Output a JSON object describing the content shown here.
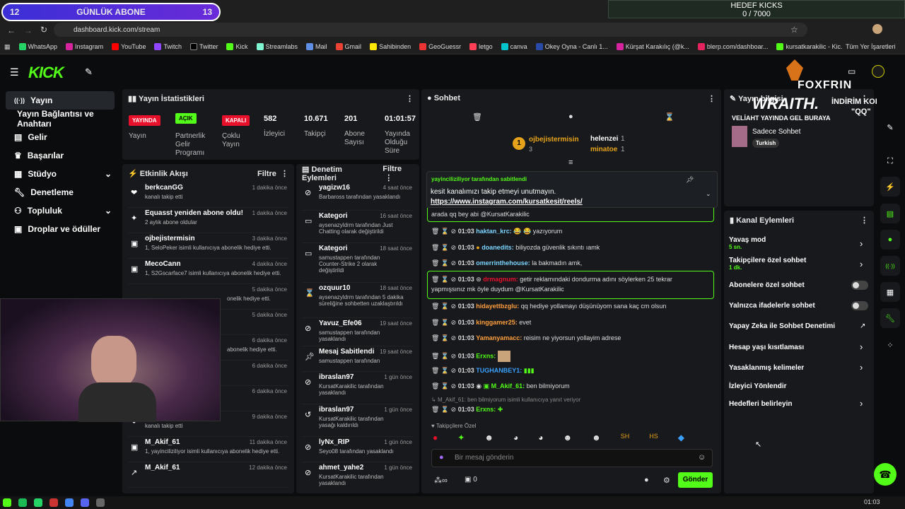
{
  "overlay": {
    "sub_left": "12",
    "sub_title": "GÜNLÜK ABONE",
    "sub_right": "13",
    "kicks_title": "HEDEF KICKS",
    "kicks_value": "0 / 7000",
    "brand": "FOXFRIN",
    "promo_title": "WRAITH.",
    "promo_text": "İNDİRİM KODU:",
    "promo_code": "\"QQ\""
  },
  "browser": {
    "url": "dashboard.kick.com/stream",
    "bookmarks": [
      "WhatsApp",
      "Instagram",
      "YouTube",
      "Twitch",
      "Twitter",
      "Kick",
      "Streamlabs",
      "Mail",
      "Gmail",
      "Sahibinden",
      "GeoGuessr",
      "letgo",
      "canva",
      "Okey Oyna - Canlı 1...",
      "Kürşat Karakılıç (@k...",
      "blerp.com/dashboar...",
      "kursatkarakilic - Kic..."
    ],
    "all_bookmarks": "Tüm Yer İşaretleri"
  },
  "app": {
    "logo": "KICK"
  },
  "sidebar": {
    "items": [
      {
        "label": "Yayın",
        "icon": "stream-icon"
      },
      {
        "label": "Yayın Bağlantısı ve Anahtarı",
        "icon": ""
      },
      {
        "label": "Gelir",
        "icon": "revenue-icon"
      },
      {
        "label": "Başarılar",
        "icon": "trophy-icon"
      },
      {
        "label": "Stüdyo",
        "icon": "studio-icon"
      },
      {
        "label": "Denetleme",
        "icon": "wrench-icon"
      },
      {
        "label": "Topluluk",
        "icon": "community-icon"
      },
      {
        "label": "Droplar ve ödüller",
        "icon": "gift-icon"
      }
    ]
  },
  "stats": {
    "title": "Yayın İstatistikleri",
    "live_badge": "YAYINDA",
    "live_label": "Yayın",
    "partner_badge": "AÇIK",
    "partner_label": "Partnerlik Gelir Programı",
    "multi_badge": "KAPALI",
    "multi_label": "Çoklu Yayın",
    "viewers": "582",
    "viewers_label": "İzleyici",
    "followers": "10.671",
    "followers_label": "Takipçi",
    "subs": "201",
    "subs_label": "Abone Sayısı",
    "uptime": "01:01:57",
    "uptime_label": "Yayında Olduğu Süre"
  },
  "activity": {
    "title": "Etkinlik Akışı",
    "filter": "Filtre",
    "events": [
      {
        "name": "berkcanGG",
        "time": "1 dakika önce",
        "desc": "kanalı takip etti"
      },
      {
        "name": "Equasst yeniden abone oldu!",
        "time": "1 dakika önce",
        "desc": "2 aylık abone oldular"
      },
      {
        "name": "ojbejistermisin",
        "time": "3 dakika önce",
        "desc": "1, SeloPeker isimli kullanıcıya abonelik hediye etti."
      },
      {
        "name": "MecoCann",
        "time": "4 dakika önce",
        "desc": "1, S2Gscarface7 isimli kullanıcıya abonelik hediye etti."
      },
      {
        "name": "",
        "time": "5 dakika önce",
        "desc": "onelik hediye etti."
      },
      {
        "name": "",
        "time": "5 dakika önce",
        "desc": ""
      },
      {
        "name": "",
        "time": "6 dakika önce",
        "desc": "abonelik hediye etti."
      },
      {
        "name": "",
        "time": "6 dakika önce",
        "desc": ""
      },
      {
        "name": "",
        "time": "6 dakika önce",
        "desc": ""
      },
      {
        "name": "myg0303",
        "time": "9 dakika önce",
        "desc": "kanalı takip etti"
      },
      {
        "name": "M_Akif_61",
        "time": "11 dakika önce",
        "desc": "1, yayinciliziliyor isimli kullanıcıya abonelik hediye etti."
      },
      {
        "name": "M_Akif_61",
        "time": "12 dakika önce",
        "desc": ""
      }
    ]
  },
  "modlog": {
    "title": "Denetim Eylemleri",
    "filter": "Filtre",
    "events": [
      {
        "name": "yagizw16",
        "time": "4 saat önce",
        "desc": "Barbaross tarafından yasaklandı"
      },
      {
        "name": "Kategori",
        "time": "16 saat önce",
        "desc": "aysenazyldrm tarafından Just Chatting olarak değiştirildi"
      },
      {
        "name": "Kategori",
        "time": "18 saat önce",
        "desc": "samustappen tarafından Counter-Strike 2 olarak değiştirildi"
      },
      {
        "name": "ozquur10",
        "time": "18 saat önce",
        "desc": "aysenazyldrm tarafından 5 dakika süreliğine sohbetten uzaklaştırıldı"
      },
      {
        "name": "Yavuz_Efe06",
        "time": "19 saat önce",
        "desc": "samustappen tarafından yasaklandı"
      },
      {
        "name": "Mesaj Sabitlendi",
        "time": "19 saat önce",
        "desc": "samustappen tarafından"
      },
      {
        "name": "ibraslan97",
        "time": "1 gün önce",
        "desc": "KursatKarakilic tarafından yasaklandı"
      },
      {
        "name": "ibraslan97",
        "time": "1 gün önce",
        "desc": "KursatKarakilic tarafından yasağı kaldırıldı"
      },
      {
        "name": "lyNx_RIP",
        "time": "1 gün önce",
        "desc": "Seyo08 tarafından yasaklandı"
      },
      {
        "name": "ahmet_yahe2",
        "time": "1 gün önce",
        "desc": "KursatKarakilic tarafından yasaklandı"
      }
    ]
  },
  "chat": {
    "title": "Sohbet",
    "top_gifter": "ojbejistermisin",
    "top_gifter_count": "3",
    "gifter2": "helenzei",
    "gifter2_count": "1",
    "gifter3": "minatoe",
    "gifter3_count": "1",
    "pinned_by": "yayinciliziliyor tarafından sabitlendi",
    "pinned_text": "kesit kanalımızı takip etmeyi unutmayın.",
    "pinned_link": "https://www.instagram.com/kursatkesit/reels/",
    "partial_msg": "arada qq bey abi @KursatKarakilic",
    "messages": [
      {
        "time": "01:03",
        "user": "haktan_krc:",
        "text": "😂 😂 yazıyorum"
      },
      {
        "time": "01:03",
        "user": "doanedits:",
        "text": "biliyozda güvenlik sıkıntı ıamk"
      },
      {
        "time": "01:03",
        "user": "omerrinthehouse:",
        "text": "la bakmadın amk,"
      },
      {
        "time": "01:03",
        "user": "drmagnum:",
        "text": "getir reklamındaki dondurma adını söylerken 25 tekrar"
      },
      {
        "time": "",
        "user": "",
        "text": "yapmışsınız mk öyle duydum @KursatKarakilic"
      },
      {
        "time": "01:03",
        "user": "hidayettbzglu:",
        "text": "qq hediye yollamayı düşünüyom sana kaç cm olsun"
      },
      {
        "time": "01:03",
        "user": "kinggamer25:",
        "text": "evet"
      },
      {
        "time": "01:03",
        "user": "Yamanyamacc:",
        "text": "reisim ne yiyorsun yollayim adrese"
      },
      {
        "time": "01:03",
        "user": "Erxns:",
        "text": ""
      },
      {
        "time": "01:03",
        "user": "TUGHANBEY1:",
        "text": ""
      },
      {
        "time": "01:03",
        "user": "M_Akif_61:",
        "text": "ben bilmiyorum"
      },
      {
        "time": "01:03",
        "user": "Erxns:",
        "text": ""
      }
    ],
    "reply_note": "M_Akif_61: ben bilmiyorum isimli kullanıcıya yanıt veriyor",
    "followers_only": "Takipçilere Özel",
    "placeholder": "Bir mesaj gönderin",
    "counter": "0",
    "send": "Gönder"
  },
  "info": {
    "title": "Yayın bilgisi",
    "stream_title": "VELİAHT YAYINDA GEL BURAYA",
    "category": "Sadece Sohbet",
    "tag": "Turkish"
  },
  "actions": {
    "title": "Kanal Eylemleri",
    "items": [
      {
        "label": "Yavaş mod",
        "sub": "5 sn."
      },
      {
        "label": "Takipçilere özel sohbet",
        "sub": "1 dk."
      },
      {
        "label": "Abonelere özel sohbet",
        "sub": ""
      },
      {
        "label": "Yalnızca ifadelerle sohbet",
        "sub": ""
      },
      {
        "label": "Yapay Zeka ile Sohbet Denetimi",
        "sub": ""
      },
      {
        "label": "Hesap yaşı kısıtlaması",
        "sub": ""
      },
      {
        "label": "Yasaklanmış kelimeler",
        "sub": ""
      },
      {
        "label": "İzleyici Yönlendir",
        "sub": ""
      },
      {
        "label": "Hedefleri belirleyin",
        "sub": ""
      }
    ]
  },
  "taskbar": {
    "time": "01:03"
  },
  "colors": {
    "accent": "#53fc18",
    "live": "#e8102b",
    "panel": "#17191c"
  }
}
